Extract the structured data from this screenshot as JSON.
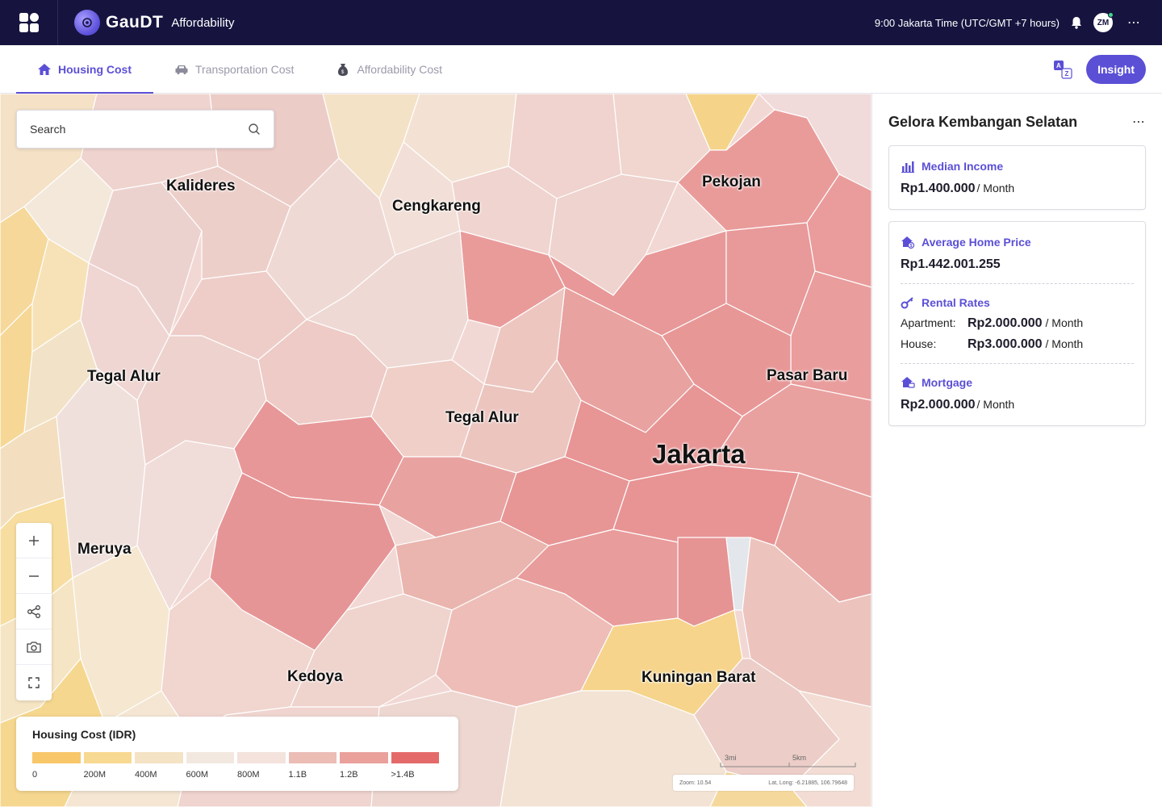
{
  "app": {
    "brand_name": "GauDT",
    "section_title": "Affordability",
    "time_text": "9:00 Jakarta Time (UTC/GMT +7 hours)",
    "avatar_initials": "ZM",
    "more_label": "⋯"
  },
  "tabs": [
    {
      "label": "Housing Cost",
      "icon": "house-icon",
      "active": true
    },
    {
      "label": "Transportation Cost",
      "icon": "car-icon",
      "active": false
    },
    {
      "label": "Affordability Cost",
      "icon": "money-bag-icon",
      "active": false
    }
  ],
  "toolbar": {
    "translate_icon": "translate-icon",
    "insight_label": "Insight"
  },
  "search": {
    "placeholder": "Search"
  },
  "map": {
    "labels": [
      {
        "text": "Kalideres"
      },
      {
        "text": "Cengkareng"
      },
      {
        "text": "Pekojan"
      },
      {
        "text": "Tegal Alur"
      },
      {
        "text": "Tegal Alur"
      },
      {
        "text": "Pasar Baru"
      },
      {
        "text": "Jakarta"
      },
      {
        "text": "Meruya"
      },
      {
        "text": "Kedoya"
      },
      {
        "text": "Kuningan Barat"
      }
    ],
    "tools": [
      "zoom-in-icon",
      "zoom-out-icon",
      "share-icon",
      "camera-icon",
      "fullscreen-icon"
    ],
    "scale": {
      "mi": "3mi",
      "km": "5km"
    },
    "zoom_text": "Zoom: 10.54",
    "latlong_text": "Lat, Long: -6.21885, 106.79648"
  },
  "legend": {
    "title": "Housing Cost (IDR)",
    "colors": [
      "#f8c76a",
      "#f8d991",
      "#f4e3c4",
      "#f3e8e0",
      "#f3e3dc",
      "#ebbdb5",
      "#eaa19c",
      "#e46a6a"
    ],
    "ticks": [
      "0",
      "200M",
      "400M",
      "600M",
      "800M",
      "1.1B",
      "1.2B",
      ">1.4B"
    ]
  },
  "panel": {
    "title": "Gelora Kembangan Selatan",
    "median_income": {
      "label": "Median Income",
      "value": "Rp1.400.000",
      "unit": "/ Month"
    },
    "home_price": {
      "label": "Average Home Price",
      "value": "Rp1.442.001.255"
    },
    "rental": {
      "label": "Rental Rates",
      "apartment_label": "Apartment:",
      "apartment_value": "Rp2.000.000",
      "house_label": "House:",
      "house_value": "Rp3.000.000",
      "unit": "/ Month"
    },
    "mortgage": {
      "label": "Mortgage",
      "value": "Rp2.000.000",
      "unit": "/ Month"
    }
  }
}
